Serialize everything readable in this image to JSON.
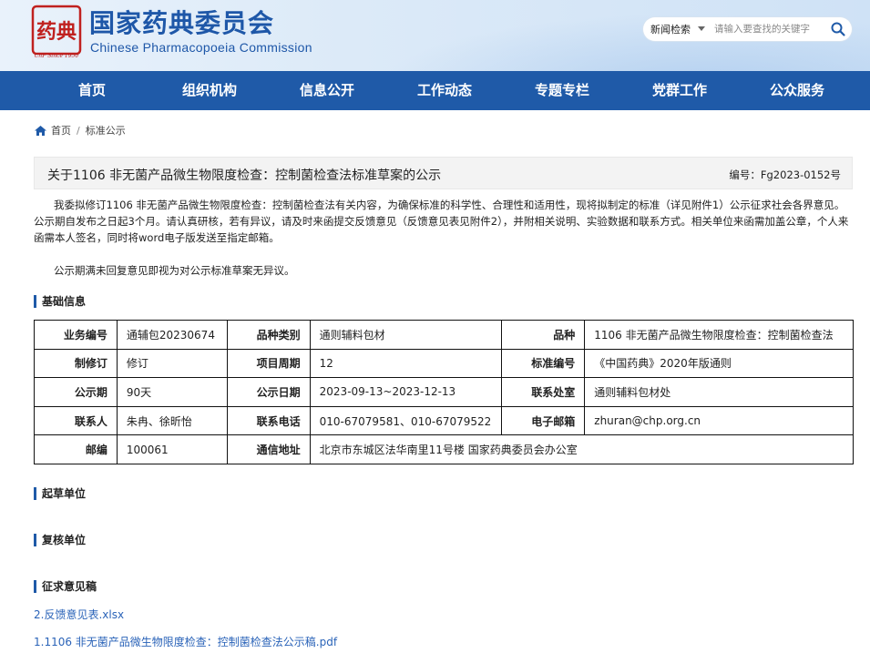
{
  "header": {
    "logo_text": "药典",
    "since": "ChP Since 1950",
    "title": "国家药典委员会",
    "subtitle": "Chinese Pharmacopoeia Commission"
  },
  "search": {
    "select_label": "新闻检索",
    "placeholder": "请输入要查找的关键字"
  },
  "nav": [
    "首页",
    "组织机构",
    "信息公开",
    "工作动态",
    "专题专栏",
    "党群工作",
    "公众服务"
  ],
  "breadcrumb": {
    "home": "首页",
    "current": "标准公示"
  },
  "article": {
    "title": "关于1106 非无菌产品微生物限度检查：控制菌检查法标准草案的公示",
    "number": "编号：Fg2023-0152号",
    "para1": "我委拟修订1106 非无菌产品微生物限度检查：控制菌检查法有关内容，为确保标准的科学性、合理性和适用性，现将拟制定的标准（详见附件1）公示征求社会各界意见。公示期自发布之日起3个月。请认真研核，若有异议，请及时来函提交反馈意见（反馈意见表见附件2），并附相关说明、实验数据和联系方式。相关单位来函需加盖公章，个人来函需本人签名，同时将word电子版发送至指定邮箱。",
    "para2": "公示期满未回复意见即视为对公示标准草案无异议。"
  },
  "sections": {
    "basic": "基础信息",
    "drafter": "起草单位",
    "reviewer": "复核单位",
    "drafts": "征求意见稿"
  },
  "table": {
    "rows": [
      [
        "业务编号",
        "通辅包20230674",
        "品种类别",
        "通则辅料包材",
        "品种",
        "1106 非无菌产品微生物限度检查：控制菌检查法"
      ],
      [
        "制修订",
        "修订",
        "项目周期",
        "12",
        "标准编号",
        "《中国药典》2020年版通则"
      ],
      [
        "公示期",
        "90天",
        "公示日期",
        "2023-09-13~2023-12-13",
        "联系处室",
        "通则辅料包材处"
      ],
      [
        "联系人",
        "朱冉、徐昕怡",
        "联系电话",
        "010-67079581、010-67079522",
        "电子邮箱",
        "zhuran@chp.org.cn"
      ]
    ],
    "last_row": [
      "邮编",
      "100061",
      "通信地址",
      "北京市东城区法华南里11号楼 国家药典委员会办公室"
    ]
  },
  "attachments": [
    "2.反馈意见表.xlsx",
    "1.1106 非无菌产品微生物限度检查：控制菌检查法公示稿.pdf"
  ],
  "colors": {
    "brand_blue": "#1f5aa8",
    "seal_red": "#c0211f",
    "link_blue": "#2a63b8"
  }
}
